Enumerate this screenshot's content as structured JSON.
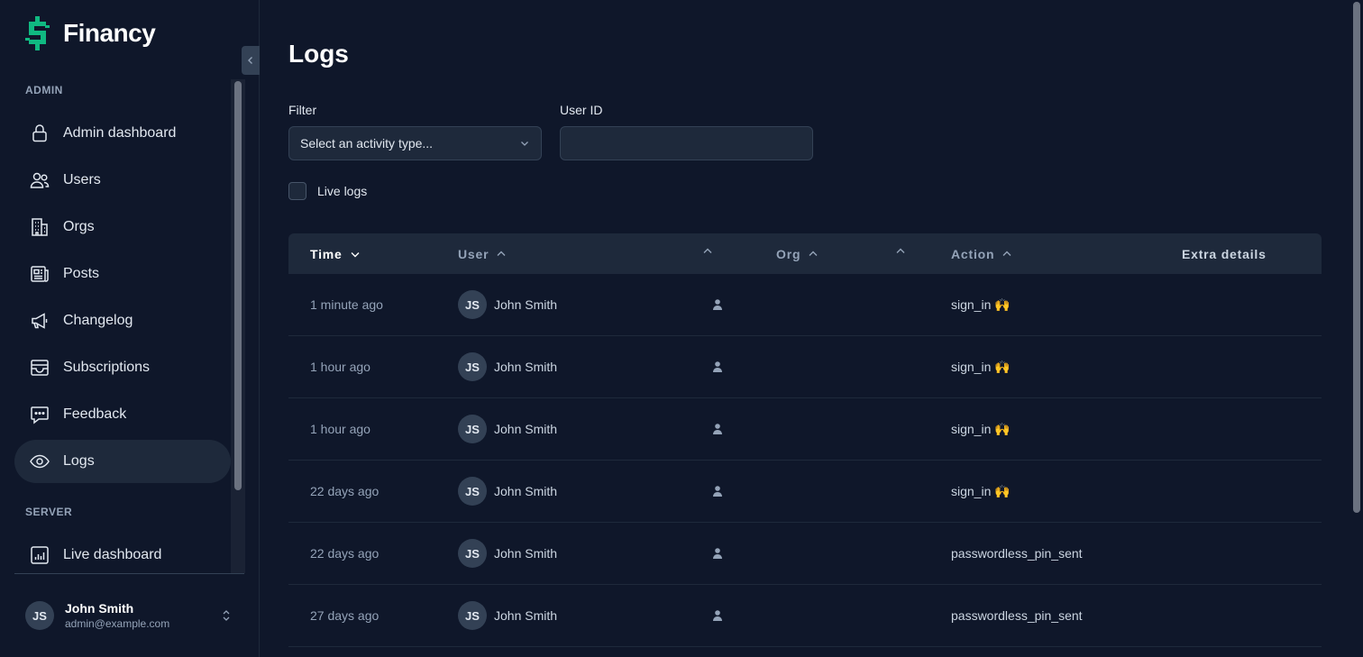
{
  "brand": {
    "name": "Financy",
    "accent": "#10b981"
  },
  "sidebar": {
    "sections": [
      {
        "label": "ADMIN"
      },
      {
        "label": "SERVER"
      }
    ],
    "items": [
      {
        "label": "Admin dashboard",
        "icon": "lock-icon"
      },
      {
        "label": "Users",
        "icon": "users-icon"
      },
      {
        "label": "Orgs",
        "icon": "building-icon"
      },
      {
        "label": "Posts",
        "icon": "newspaper-icon"
      },
      {
        "label": "Changelog",
        "icon": "megaphone-icon"
      },
      {
        "label": "Subscriptions",
        "icon": "inbox-icon"
      },
      {
        "label": "Feedback",
        "icon": "chat-icon"
      },
      {
        "label": "Logs",
        "icon": "eye-icon",
        "active": true
      },
      {
        "label": "Live dashboard",
        "icon": "chart-icon"
      }
    ],
    "user": {
      "initials": "JS",
      "name": "John Smith",
      "email": "admin@example.com"
    }
  },
  "main": {
    "title": "Logs",
    "filter": {
      "label": "Filter",
      "placeholder": "Select an activity type..."
    },
    "user_id": {
      "label": "User ID",
      "value": ""
    },
    "live_logs": {
      "label": "Live logs",
      "checked": false
    },
    "table": {
      "columns": {
        "time": "Time",
        "user": "User",
        "org": "Org",
        "action": "Action",
        "extra": "Extra details"
      },
      "rows": [
        {
          "time": "1 minute ago",
          "initials": "JS",
          "user": "John Smith",
          "action": "sign_in 🙌"
        },
        {
          "time": "1 hour ago",
          "initials": "JS",
          "user": "John Smith",
          "action": "sign_in 🙌"
        },
        {
          "time": "1 hour ago",
          "initials": "JS",
          "user": "John Smith",
          "action": "sign_in 🙌"
        },
        {
          "time": "22 days ago",
          "initials": "JS",
          "user": "John Smith",
          "action": "sign_in 🙌"
        },
        {
          "time": "22 days ago",
          "initials": "JS",
          "user": "John Smith",
          "action": "passwordless_pin_sent"
        },
        {
          "time": "27 days ago",
          "initials": "JS",
          "user": "John Smith",
          "action": "passwordless_pin_sent"
        }
      ]
    }
  }
}
